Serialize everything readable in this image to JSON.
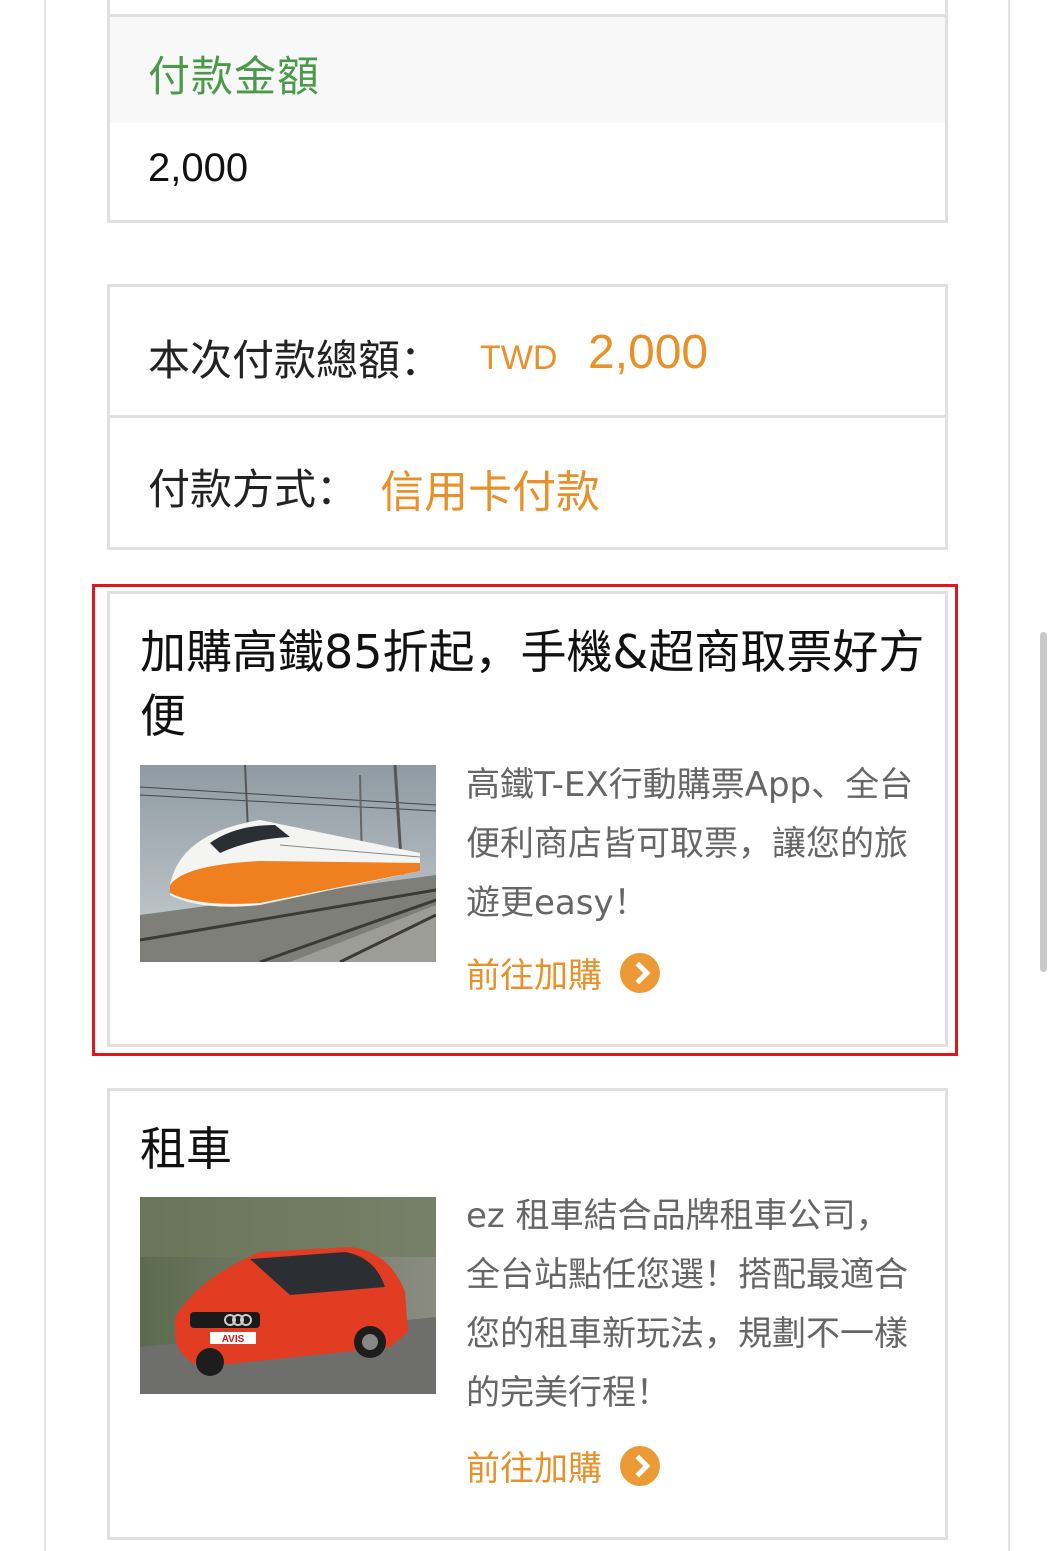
{
  "payment_amount": {
    "label": "付款金額",
    "value": "2,000"
  },
  "summary": {
    "total_label": "本次付款總額：",
    "currency": "TWD",
    "total_value": "2,000",
    "method_label": "付款方式：",
    "method_value": "信用卡付款"
  },
  "promos": [
    {
      "title": "加購高鐵85折起，手機&超商取票好方便",
      "description": "高鐵T-EX行動購票App、全台便利商店皆可取票，讓您的旅遊更easy！",
      "link_label": "前往加購",
      "image": "high-speed-train-photo"
    },
    {
      "title": "租車",
      "description": "ez 租車結合品牌租車公司，全台站點任您選！搭配最適合您的租車新玩法，規劃不一樣的完美行程！",
      "link_label": "前往加購",
      "image": "red-car-photo",
      "image_text": "AVIS"
    }
  ],
  "colors": {
    "accent": "#e8912b",
    "green_label": "#4a9a4a",
    "highlight": "#e0161a"
  }
}
